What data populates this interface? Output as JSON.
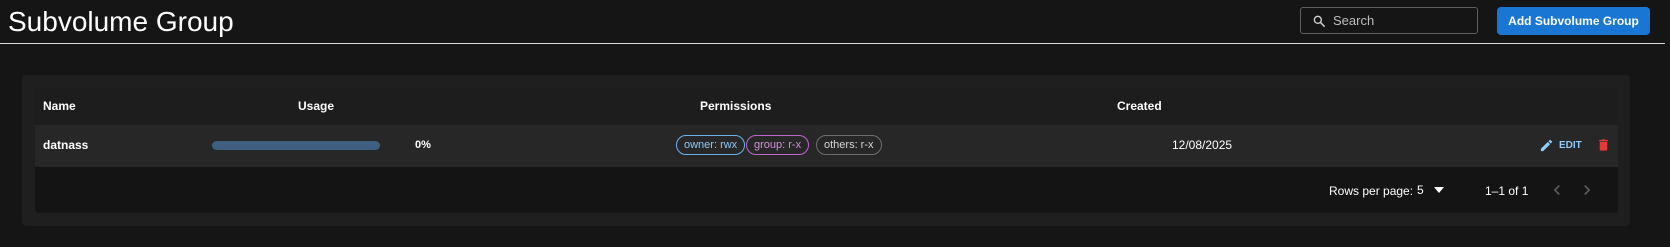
{
  "header": {
    "title": "Subvolume Group",
    "search": {
      "placeholder": "Search",
      "value": ""
    },
    "add_button_label": "Add Subvolume Group"
  },
  "table": {
    "columns": [
      "Name",
      "Usage",
      "Permissions",
      "Created"
    ],
    "rows": [
      {
        "name": "datnass",
        "usage_percent_label": "0%",
        "usage_fraction": 0,
        "permissions": {
          "owner": "owner: rwx",
          "group": "group: r-x",
          "others": "others: r-x"
        },
        "created": "12/08/2025",
        "edit_label": "EDIT"
      }
    ]
  },
  "pagination": {
    "rows_per_page_label": "Rows per page:",
    "rows_per_page_value": "5",
    "range_text": "1–1 of 1"
  },
  "colors": {
    "primary": "#1976d2",
    "edit": "#90caf9",
    "delete": "#e53935",
    "owner_chip": "#6ab4ee",
    "group_chip": "#ba68c8",
    "others_chip": "#6e6e6e"
  },
  "icons": {
    "search": "search-icon",
    "edit": "pencil-icon",
    "delete": "trash-icon",
    "rows_dropdown": "chevron-down-icon",
    "prev": "chevron-left-icon",
    "next": "chevron-right-icon"
  }
}
